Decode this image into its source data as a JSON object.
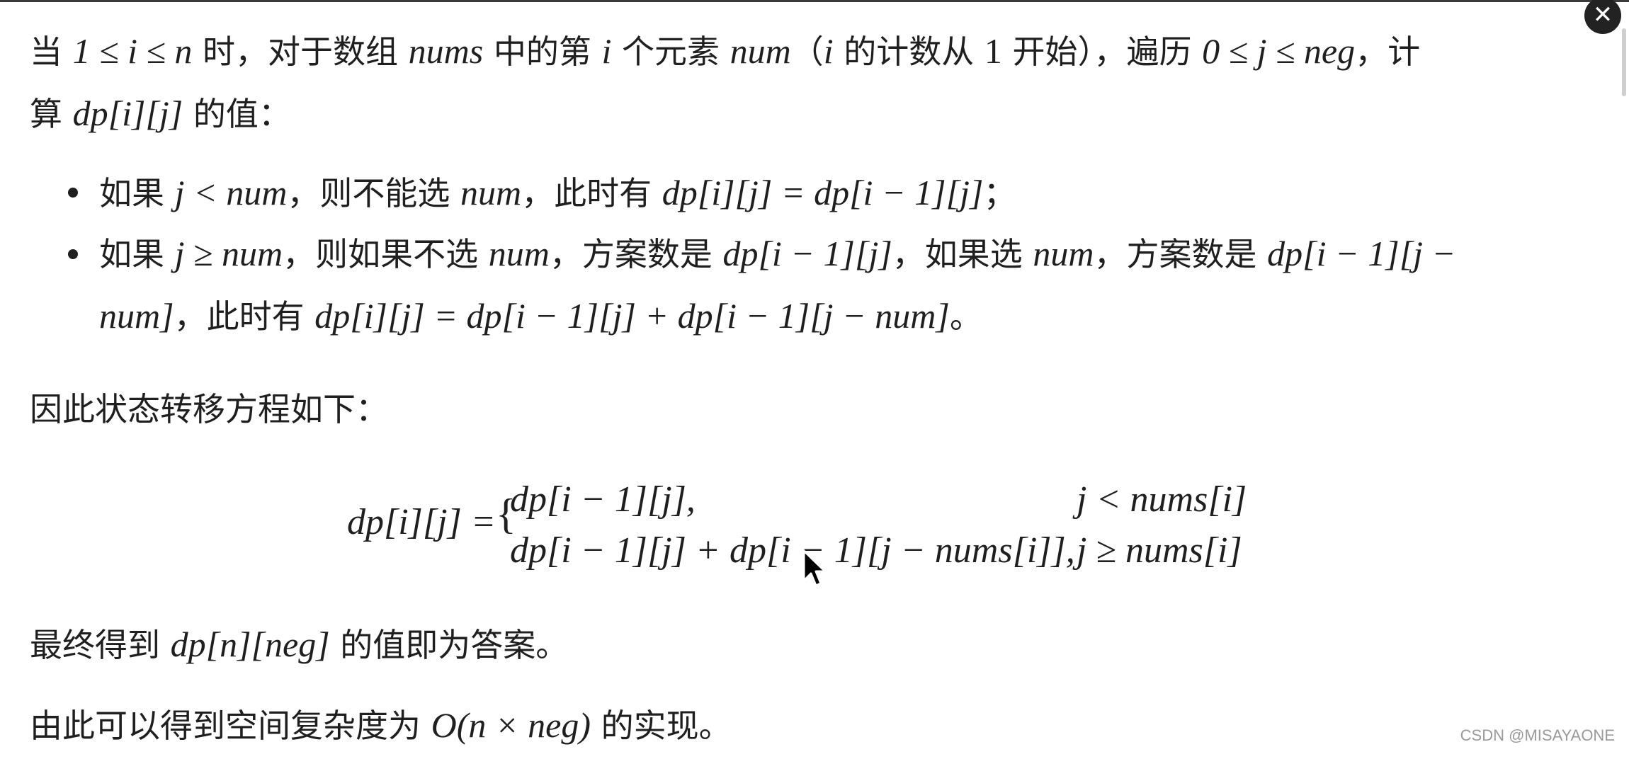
{
  "page": {
    "p1_line1": {
      "t1": "当 ",
      "m1": "1 ≤ i ≤ n",
      "t2": " 时，对于数组 ",
      "m2": "nums",
      "t3": " 中的第 ",
      "m3": "i",
      "t4": " 个元素 ",
      "m4": "num",
      "t5": "（",
      "m5": "i",
      "t6": " 的计数从 ",
      "m6": "1",
      "t7": " 开始），遍历 ",
      "m7": "0 ≤ j ≤ neg",
      "t8": "，计"
    },
    "p1_line2": {
      "t1": "算 ",
      "m1": "dp[i][j]",
      "t2": " 的值："
    },
    "bullet1": {
      "t1": "如果 ",
      "m1": "j < num",
      "t2": "，则不能选 ",
      "m2": "num",
      "t3": "，此时有 ",
      "m3": "dp[i][j] = dp[i − 1][j]",
      "t4": "；"
    },
    "bullet2_line1": {
      "t1": "如果 ",
      "m1": "j ≥ num",
      "t2": "，则如果不选 ",
      "m2": "num",
      "t3": "，方案数是 ",
      "m3": "dp[i − 1][j]",
      "t4": "，如果选 ",
      "m4": "num",
      "t5": "，方案数是 ",
      "m5": "dp[i − 1][j −"
    },
    "bullet2_line2": {
      "m1": "num]",
      "t1": "，此时有 ",
      "m2": "dp[i][j] = dp[i − 1][j] + dp[i − 1][j − num]",
      "t2": "。"
    },
    "p2": "因此状态转移方程如下：",
    "formula": {
      "lhs": "dp[i][j] = ",
      "brace": "{",
      "case1_expr": "dp[i − 1][j],",
      "case1_cond": "j < nums[i]",
      "case2_expr": "dp[i − 1][j] + dp[i − 1][j − nums[i]],",
      "case2_cond": "j ≥ nums[i]"
    },
    "p3": {
      "t1": "最终得到 ",
      "m1": "dp[n][neg]",
      "t2": " 的值即为答案。"
    },
    "p4": {
      "t1": "由此可以得到空间复杂度为 ",
      "m1": "O(n × neg)",
      "t2": " 的实现。"
    }
  },
  "ui": {
    "close_icon": "✕",
    "watermark": "CSDN @MISAYAONE"
  }
}
